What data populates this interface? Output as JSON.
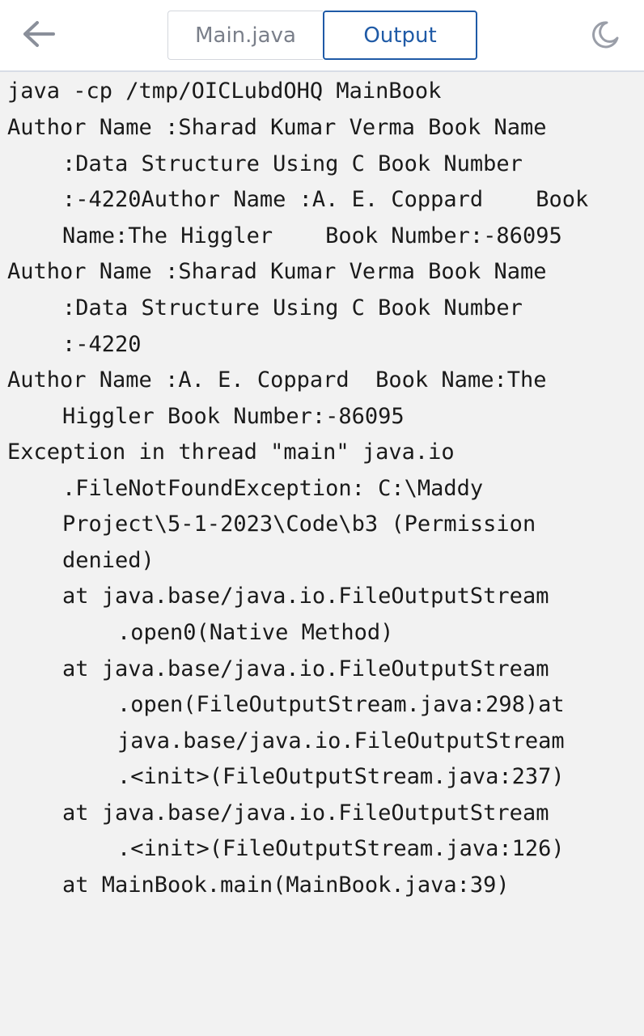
{
  "header": {
    "back_icon": "arrow-left-icon",
    "tabs": [
      {
        "label": "Main.java",
        "active": false
      },
      {
        "label": "Output",
        "active": true
      }
    ],
    "theme_icon": "moon-icon",
    "accent_color": "#1f5aa6"
  },
  "output": {
    "lines": [
      "java -cp /tmp/OICLubdOHQ MainBook",
      "Author Name :Sharad Kumar Verma Book Name",
      ":Data Structure Using C Book Number",
      ":-4220Author Name :A. E. Coppard    Book",
      "Name:The Higgler    Book Number:-86095",
      "Author Name :Sharad Kumar Verma Book Name",
      ":Data Structure Using C Book Number",
      ":-4220",
      "Author Name :A. E. Coppard  Book Name:The",
      "Higgler Book Number:-86095",
      "Exception in thread \"main\" java.io",
      ".FileNotFoundException: C:\\Maddy",
      "Project\\5-1-2023\\Code\\b3 (Permission",
      "denied)",
      "at java.base/java.io.FileOutputStream",
      ".open0(Native Method)",
      "at java.base/java.io.FileOutputStream",
      ".open(FileOutputStream.java:298)at",
      "java.base/java.io.FileOutputStream",
      ".<init>(FileOutputStream.java:237)",
      "at java.base/java.io.FileOutputStream",
      ".<init>(FileOutputStream.java:126)",
      "at MainBook.main(MainBook.java:39)"
    ]
  }
}
